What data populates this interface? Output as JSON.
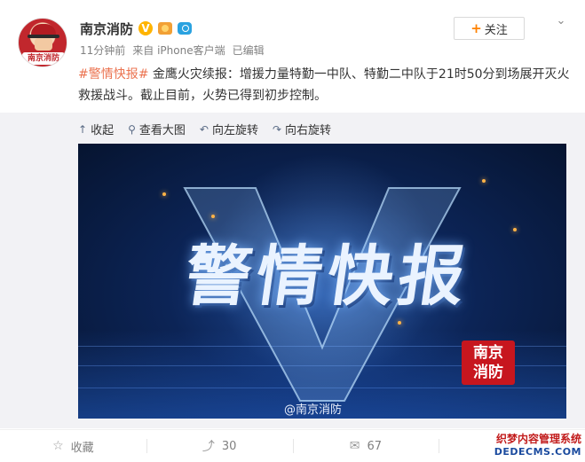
{
  "user": {
    "name": "南京消防",
    "avatar_text": "南京消防",
    "time": "11分钟前",
    "source": "来自 iPhone客户端",
    "edited": "已编辑"
  },
  "follow": {
    "plus": "+",
    "label": "关注"
  },
  "menu_icon": "chevron-down-icon",
  "post": {
    "hashtag": "#警情快报#",
    "text": " 金鹰火灾续报：增援力量特勤一中队、特勤二中队于21时50分到场展开灭火救援战斗。截止目前，火势已得到初步控制。"
  },
  "media_toolbar": {
    "collapse": "收起",
    "view_large": "查看大图",
    "rotate_left": "向左旋转",
    "rotate_right": "向右旋转"
  },
  "media": {
    "title": "警情快报",
    "logo_line1": "南京",
    "logo_line2": "消防",
    "watermark": "@南京消防"
  },
  "actions": {
    "favorite": "收藏",
    "repost_count": "30",
    "comment_count": "67"
  },
  "site_stamp": {
    "line1": "织梦内容管理系统",
    "line2": "DEDECMS.COM"
  },
  "colors": {
    "hashtag": "#eb7350",
    "follow_plus": "#ff8200",
    "verified": "#ffb400"
  }
}
